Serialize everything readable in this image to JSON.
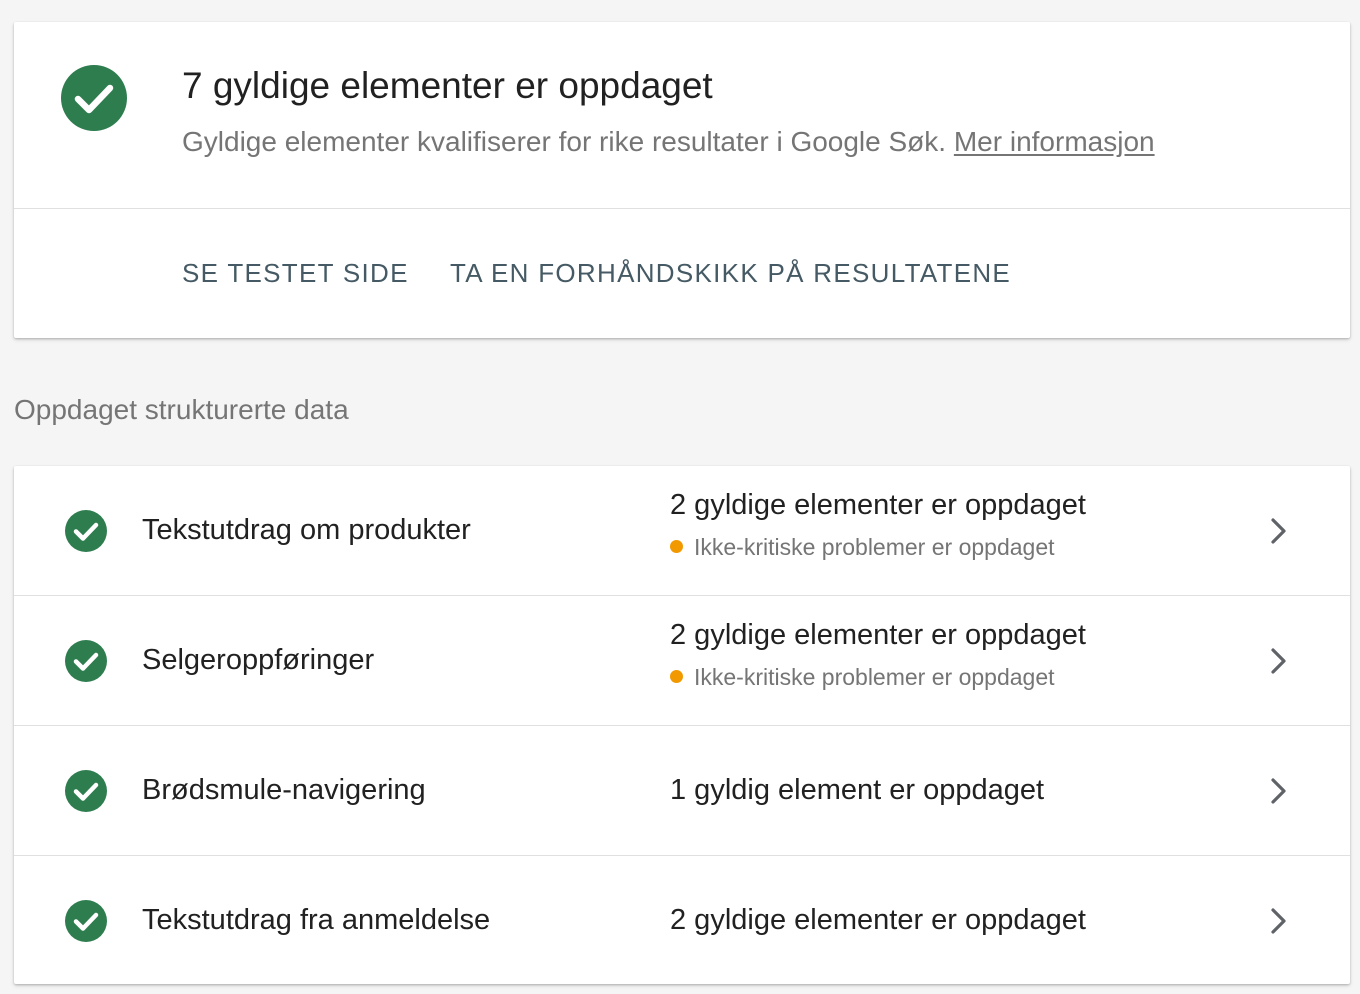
{
  "colors": {
    "success_green": "#34a853",
    "success_green_dark": "#2e7d32",
    "warning_orange": "#f29900",
    "action_text": "#455a64"
  },
  "summary": {
    "icon": "check-circle-icon",
    "title": "7 gyldige elementer er oppdaget",
    "subtitle": "Gyldige elementer kvalifiserer for rike resultater i Google Søk.",
    "more_info_link": "Mer informasjon",
    "actions": [
      "SE TESTET SIDE",
      "TA EN FORHÅNDSKIKK PÅ RESULTATENE"
    ]
  },
  "section_title": "Oppdaget strukturerte data",
  "items": [
    {
      "name": "Tekstutdrag om produkter",
      "status": "2 gyldige elementer er oppdaget",
      "warning": "Ikke-kritiske problemer er oppdaget"
    },
    {
      "name": "Selgeroppføringer",
      "status": "2 gyldige elementer er oppdaget",
      "warning": "Ikke-kritiske problemer er oppdaget"
    },
    {
      "name": "Brødsmule-navigering",
      "status": "1 gyldig element er oppdaget",
      "warning": null
    },
    {
      "name": "Tekstutdrag fra anmeldelse",
      "status": "2 gyldige elementer er oppdaget",
      "warning": null
    }
  ]
}
